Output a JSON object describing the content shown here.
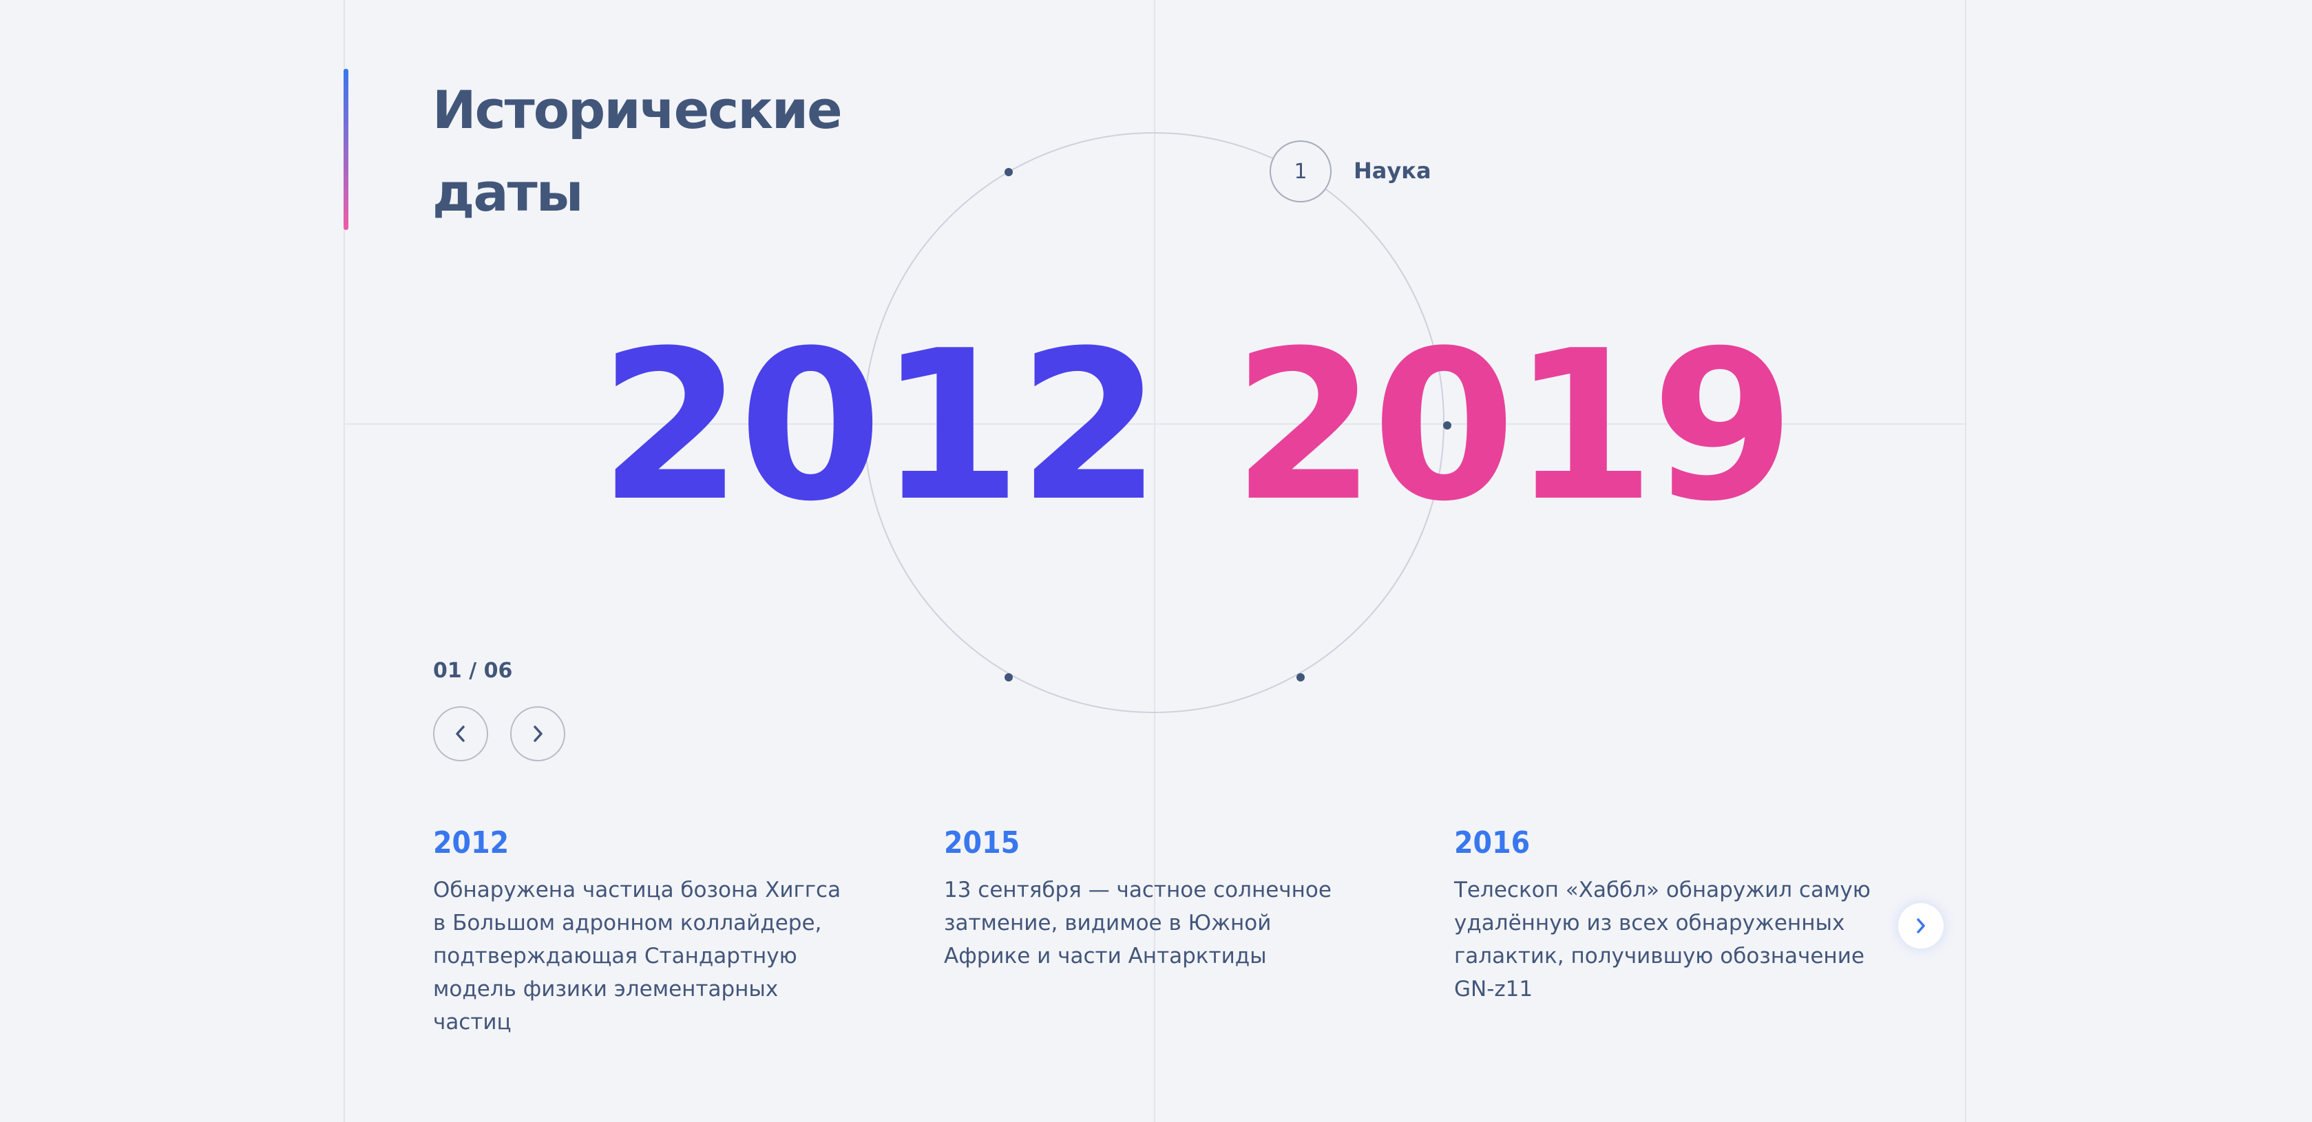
{
  "title": {
    "line1": "Исторические",
    "line2": "даты"
  },
  "circle": {
    "active_index": "1",
    "active_label": "Наука"
  },
  "period": {
    "start_year": "2012",
    "end_year": "2019"
  },
  "pagination": {
    "counter": "01 / 06"
  },
  "events": [
    {
      "year": "2012",
      "text": "Обнаружена частица бозона Хиггса в Большом адронном коллайдере, подтверждающая Стандартную модель физики элементарных частиц"
    },
    {
      "year": "2015",
      "text": "13 сентября — частное солнечное затмение, видимое в Южной Африке и части Антарктиды"
    },
    {
      "year": "2016",
      "text": "Телескоп «Хаббл» обнаружил самую удалённую из всех обнаруженных галактик, получившую обозначение GN-z11"
    }
  ],
  "colors": {
    "text": "#42567A",
    "accent_blue": "#3877EE",
    "start_year": "#4A41EA",
    "end_year": "#E8419A",
    "background": "#F3F4F8"
  },
  "icons": {
    "prev": "chevron-left-icon",
    "next": "chevron-right-icon",
    "slider_next": "chevron-right-icon"
  }
}
